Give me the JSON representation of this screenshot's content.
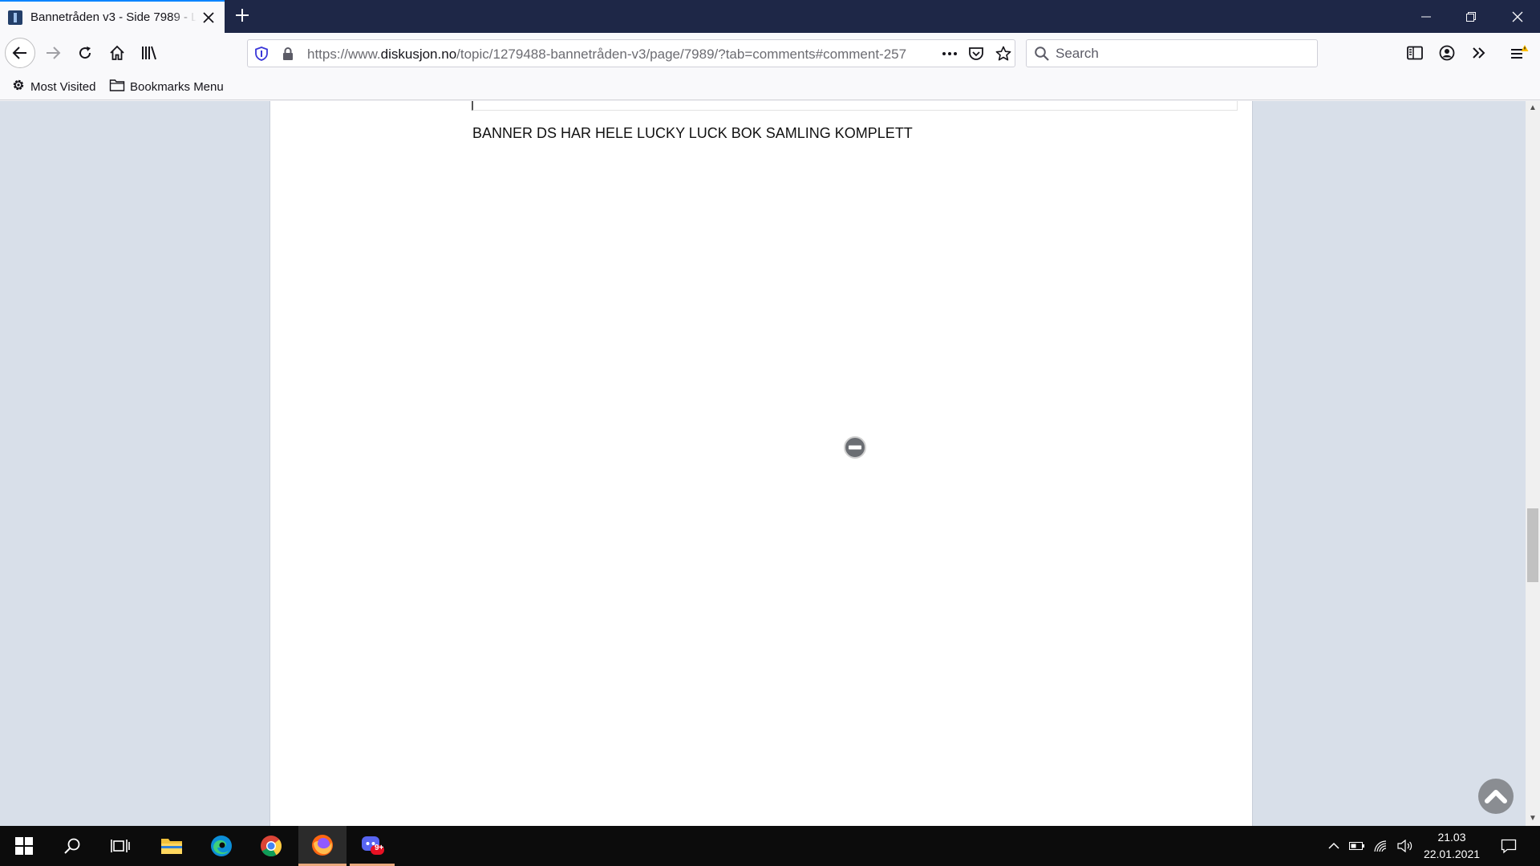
{
  "browser": {
    "tab": {
      "title": "Bannetråden v3 - Side 7989 - Li"
    },
    "url": {
      "prefix": "https://www.",
      "host": "diskusjon.no",
      "path": "/topic/1279488-bannetråden-v3/page/7989/?tab=comments#comment-257"
    },
    "search": {
      "placeholder": "Search"
    },
    "bookmarks": [
      {
        "label": "Most Visited",
        "icon": "gear-icon"
      },
      {
        "label": "Bookmarks Menu",
        "icon": "folder-icon"
      }
    ]
  },
  "post": {
    "text": "BANNER DS HAR HELE LUCKY LUCK BOK SAMLING KOMPLETT"
  },
  "taskbar": {
    "apps": [
      "windows-start",
      "search",
      "task-view",
      "file-explorer",
      "edge",
      "chrome",
      "firefox",
      "discord"
    ],
    "discord_badge": "9+",
    "clock": {
      "time": "21.03",
      "date": "22.01.2021"
    }
  },
  "colors": {
    "tabstrip": "#1e2747",
    "accent": "#0a84ff",
    "page_background": "#d8dfe9",
    "taskbar": "#0c0c0c"
  }
}
